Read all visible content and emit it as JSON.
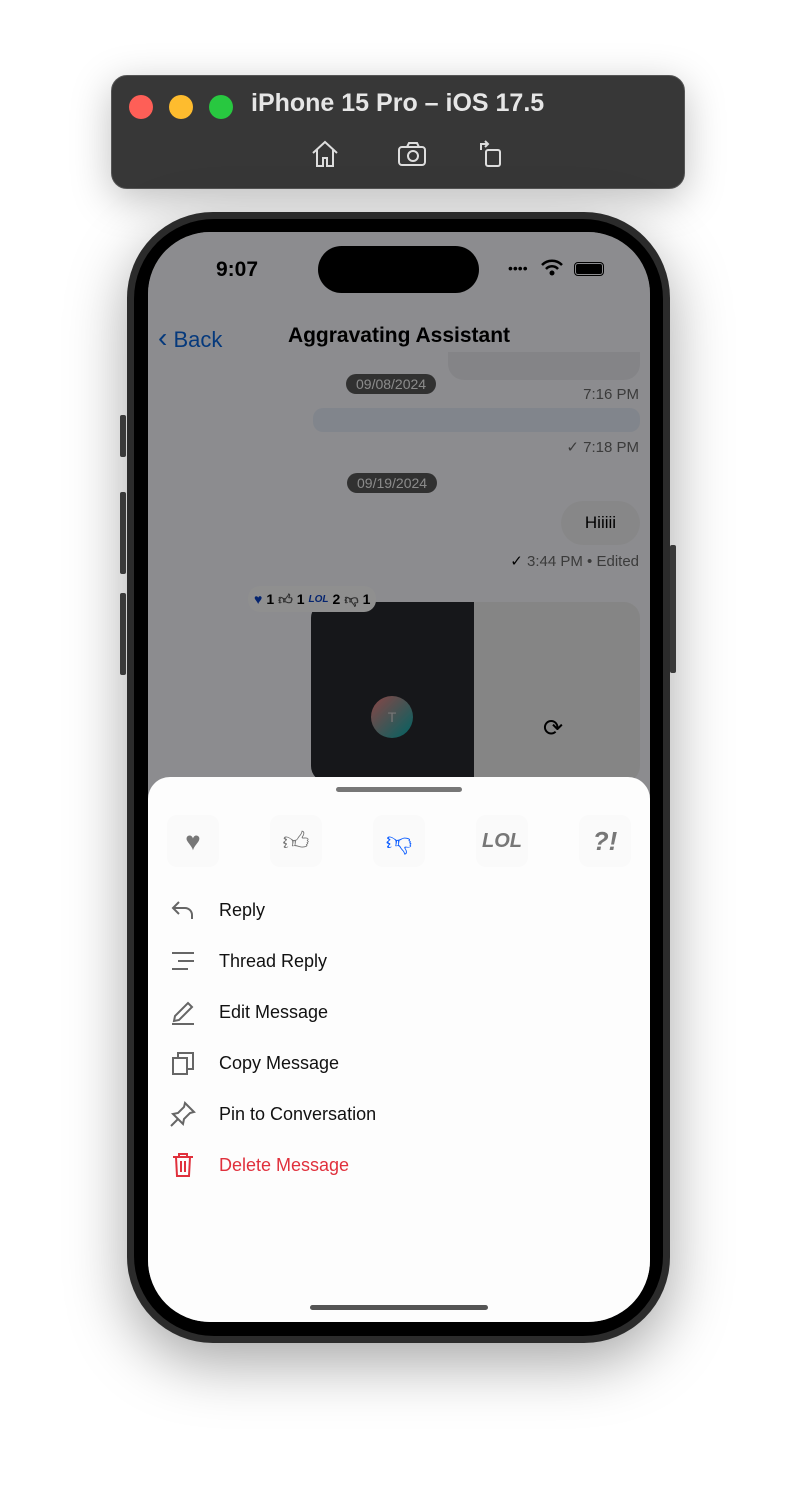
{
  "simulator": {
    "title": "iPhone 15 Pro – iOS 17.5",
    "icons": [
      "home-icon",
      "screenshot-icon",
      "rotate-icon"
    ],
    "traffic_lights": [
      "#fe5f57",
      "#febc2e",
      "#28c840"
    ]
  },
  "status_bar": {
    "time": "9:07"
  },
  "nav": {
    "back_label": "Back",
    "title": "Aggravating Assistant"
  },
  "chat": {
    "date1": "09/08/2024",
    "time1": "7:16 PM",
    "time2": "7:18 PM",
    "date2": "09/19/2024",
    "message": "Hiiiii",
    "msg_time": "3:44 PM",
    "msg_edited": "• Edited",
    "reactions": [
      {
        "icon": "heart-icon",
        "count": "1"
      },
      {
        "icon": "thumbs-up-icon",
        "count": "1"
      },
      {
        "icon": "lol-icon",
        "count": "2"
      },
      {
        "icon": "thumbs-down-icon",
        "count": "1"
      }
    ],
    "avatar_initial": "T"
  },
  "sheet": {
    "reactions": [
      {
        "name": "heart",
        "selected": false
      },
      {
        "name": "thumbs-up",
        "selected": false
      },
      {
        "name": "thumbs-down",
        "selected": true
      },
      {
        "name": "lol",
        "label": "LOL",
        "selected": false
      },
      {
        "name": "wut",
        "label": "?!",
        "selected": false
      }
    ],
    "accent": "#0a5cff",
    "menu": [
      {
        "label": "Reply",
        "icon": "reply-icon"
      },
      {
        "label": "Thread Reply",
        "icon": "thread-reply-icon"
      },
      {
        "label": "Edit Message",
        "icon": "pencil-icon"
      },
      {
        "label": "Copy Message",
        "icon": "copy-icon"
      },
      {
        "label": "Pin to Conversation",
        "icon": "pin-icon"
      },
      {
        "label": "Delete Message",
        "icon": "trash-icon",
        "color": "#e0303c"
      }
    ]
  }
}
